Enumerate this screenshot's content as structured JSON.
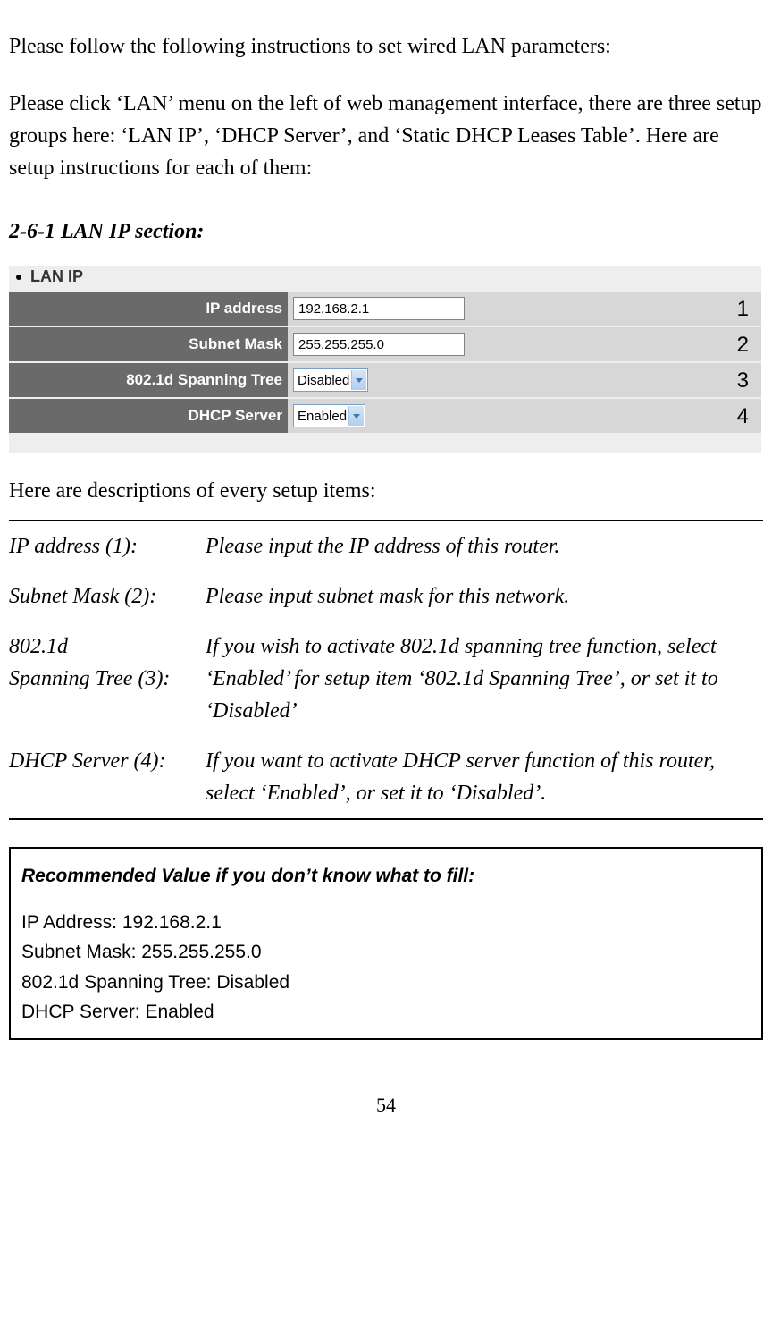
{
  "intro1": "Please follow the following instructions to set wired LAN parameters:",
  "intro2": "Please click ‘LAN’ menu on the left of web management interface, there are three setup groups here: ‘LAN IP’, ‘DHCP Server’, and ‘Static DHCP Leases Table’. Here are setup instructions for each of them:",
  "section_heading": "2-6-1 LAN IP section:",
  "screenshot": {
    "header": "LAN IP",
    "rows": [
      {
        "label": "IP address",
        "value": "192.168.2.1",
        "type": "text",
        "callout": "1"
      },
      {
        "label": "Subnet Mask",
        "value": "255.255.255.0",
        "type": "text",
        "callout": "2"
      },
      {
        "label": "802.1d Spanning Tree",
        "value": "Disabled",
        "type": "select",
        "callout": "3"
      },
      {
        "label": "DHCP Server",
        "value": "Enabled",
        "type": "select",
        "callout": "4"
      }
    ]
  },
  "desc_intro": "Here are descriptions of every setup items:",
  "descriptions": [
    {
      "label": "IP address (1):",
      "text": "Please input the IP address of this router."
    },
    {
      "label": "Subnet Mask (2):",
      "text": "Please input subnet mask for this network."
    },
    {
      "label": "802.1d\nSpanning Tree (3):",
      "text": "If you wish to activate 802.1d spanning tree function, select ‘Enabled’ for setup item ‘802.1d Spanning Tree’, or set it to ‘Disabled’"
    },
    {
      "label": "DHCP Server (4):",
      "text": "If you want to activate DHCP server function of this router, select ‘Enabled’, or set it to ‘Disabled’."
    }
  ],
  "recommended": {
    "title": "Recommended Value if you don’t know what to fill:",
    "lines": [
      "IP Address: 192.168.2.1",
      "Subnet Mask: 255.255.255.0",
      "802.1d Spanning Tree: Disabled",
      "DHCP Server: Enabled"
    ]
  },
  "page_number": "54"
}
